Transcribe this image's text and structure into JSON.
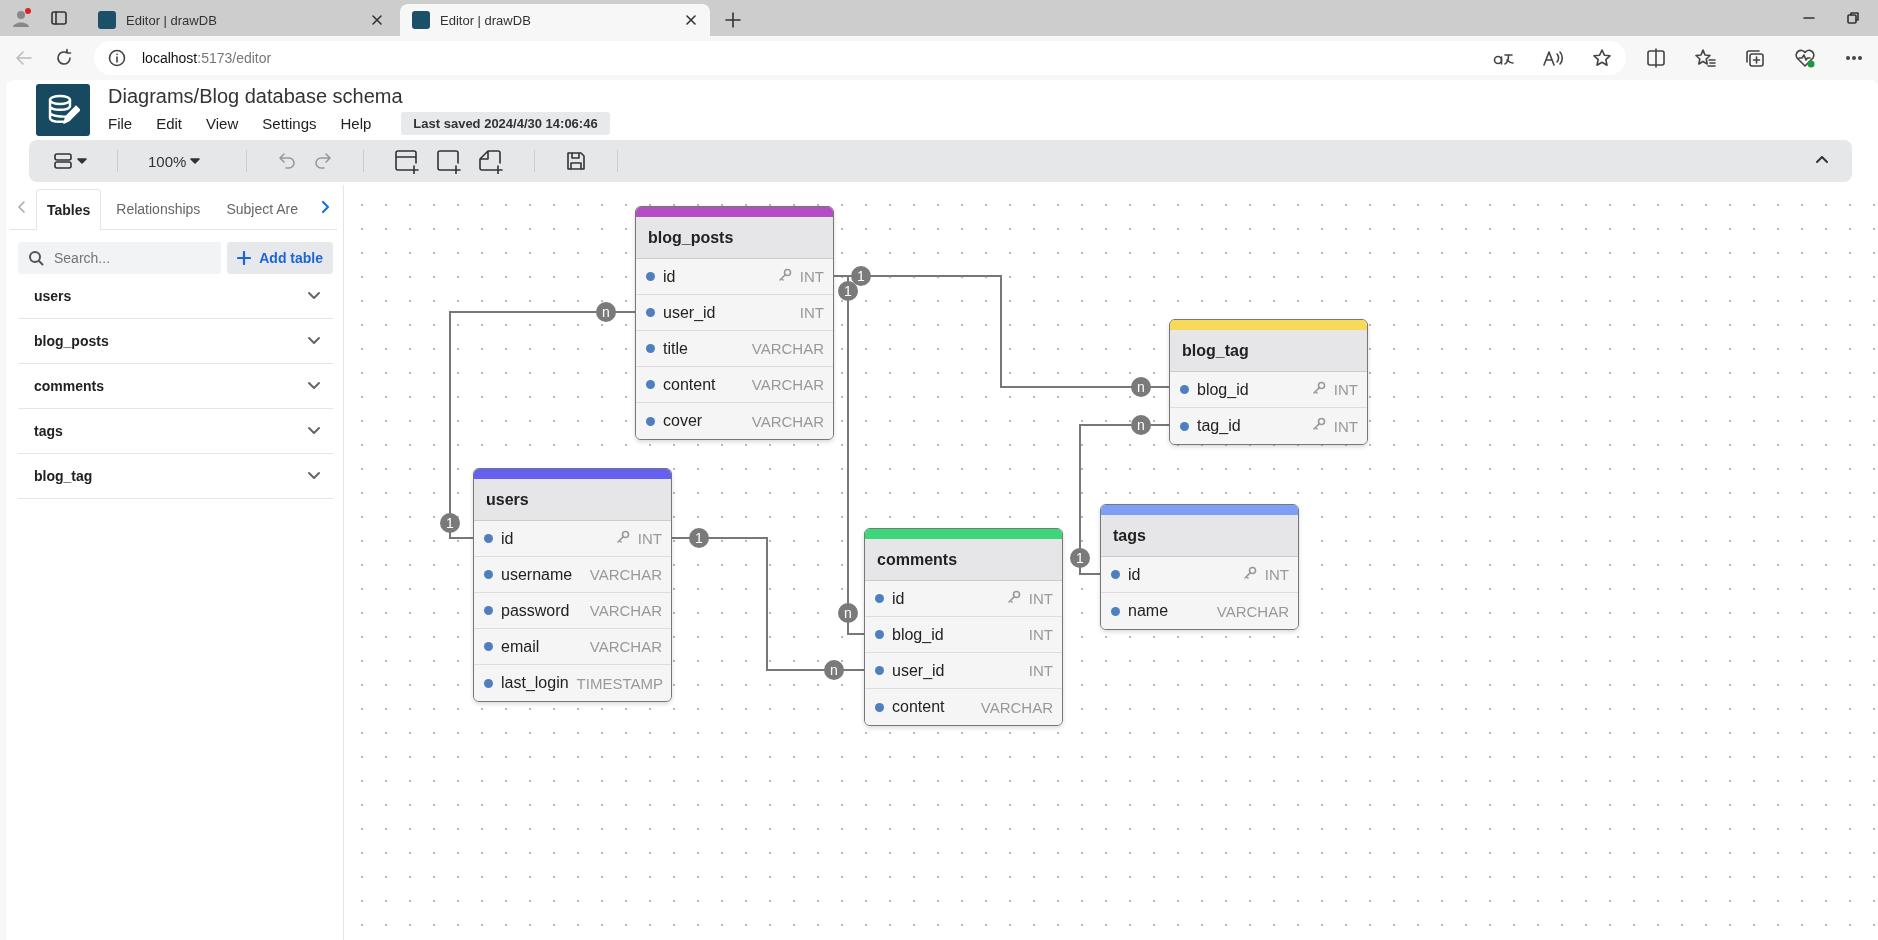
{
  "browser": {
    "tabs": [
      {
        "title": "Editor | drawDB",
        "selected": false
      },
      {
        "title": "Editor | drawDB",
        "selected": true
      }
    ],
    "address": {
      "host": "localhost",
      "path": ":5173/editor"
    }
  },
  "app": {
    "title": "Diagrams/Blog database schema",
    "menu": [
      "File",
      "Edit",
      "View",
      "Settings",
      "Help"
    ],
    "last_saved": "Last saved 2024/4/30 14:06:46"
  },
  "toolbar": {
    "zoom": "100%"
  },
  "sidebar": {
    "tabs": [
      {
        "label": "Tables",
        "selected": true
      },
      {
        "label": "Relationships",
        "selected": false
      },
      {
        "label": "Subject Are",
        "selected": false
      }
    ],
    "search": {
      "placeholder": "Search..."
    },
    "add_button": "Add table",
    "items": [
      {
        "name": "users"
      },
      {
        "name": "blog_posts"
      },
      {
        "name": "comments"
      },
      {
        "name": "tags"
      },
      {
        "name": "blog_tag"
      }
    ]
  },
  "diagram": {
    "tables": [
      {
        "name": "blog_posts",
        "color": "#b44ec4",
        "fields": [
          {
            "name": "id",
            "type": "INT",
            "primary": true
          },
          {
            "name": "user_id",
            "type": "INT",
            "primary": false
          },
          {
            "name": "title",
            "type": "VARCHAR",
            "primary": false
          },
          {
            "name": "content",
            "type": "VARCHAR",
            "primary": false
          },
          {
            "name": "cover",
            "type": "VARCHAR",
            "primary": false
          }
        ]
      },
      {
        "name": "users",
        "color": "#6660f0",
        "fields": [
          {
            "name": "id",
            "type": "INT",
            "primary": true
          },
          {
            "name": "username",
            "type": "VARCHAR",
            "primary": false
          },
          {
            "name": "password",
            "type": "VARCHAR",
            "primary": false
          },
          {
            "name": "email",
            "type": "VARCHAR",
            "primary": false
          },
          {
            "name": "last_login",
            "type": "TIMESTAMP",
            "primary": false
          }
        ]
      },
      {
        "name": "comments",
        "color": "#3ed67a",
        "fields": [
          {
            "name": "id",
            "type": "INT",
            "primary": true
          },
          {
            "name": "blog_id",
            "type": "INT",
            "primary": false
          },
          {
            "name": "user_id",
            "type": "INT",
            "primary": false
          },
          {
            "name": "content",
            "type": "VARCHAR",
            "primary": false
          }
        ]
      },
      {
        "name": "blog_tag",
        "color": "#f7da5a",
        "fields": [
          {
            "name": "blog_id",
            "type": "INT",
            "primary": true
          },
          {
            "name": "tag_id",
            "type": "INT",
            "primary": true
          }
        ]
      },
      {
        "name": "tags",
        "color": "#7d9ff5",
        "fields": [
          {
            "name": "id",
            "type": "INT",
            "primary": true
          },
          {
            "name": "name",
            "type": "VARCHAR",
            "primary": false
          }
        ]
      }
    ],
    "relationships": [
      {
        "start": "n",
        "end": "1"
      },
      {
        "start": "1",
        "end": "n"
      },
      {
        "start": "1",
        "end": "n"
      },
      {
        "start": "1",
        "end": "n"
      },
      {
        "start": "1",
        "end": "n"
      }
    ]
  }
}
